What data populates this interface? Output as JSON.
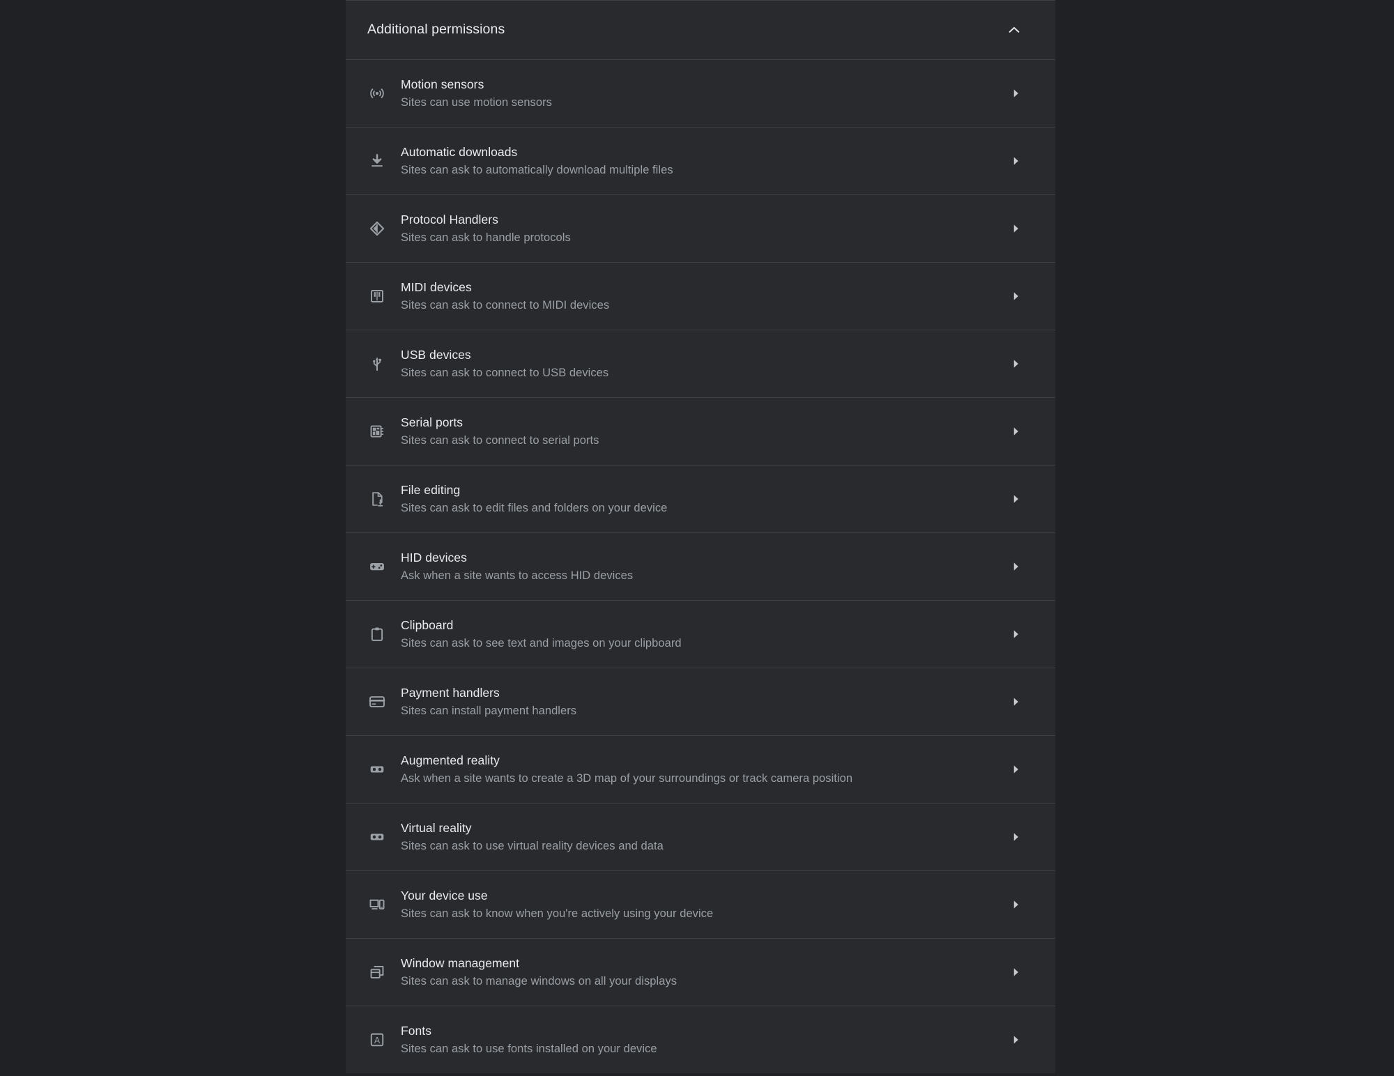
{
  "theme": {
    "page_bg": "#202124",
    "card_bg": "#292a2d",
    "divider": "#3c4043",
    "title_color": "#e8eaed",
    "desc_color": "#9aa0a6",
    "icon_color": "#9aa0a6",
    "arrow_color": "#c5c8cc"
  },
  "section": {
    "header_title": "Additional permissions",
    "collapse_icon": "chevron-up-icon",
    "expanded": true
  },
  "permissions": [
    {
      "id": "motion-sensors",
      "title": "Motion sensors",
      "description": "Sites can use motion sensors",
      "icon": "motion-sensor-icon",
      "arrow": "chevron-right-icon"
    },
    {
      "id": "automatic-downloads",
      "title": "Automatic downloads",
      "description": "Sites can ask to automatically download multiple files",
      "icon": "download-icon",
      "arrow": "chevron-right-icon"
    },
    {
      "id": "protocol-handlers",
      "title": "Protocol Handlers",
      "description": "Sites can ask to handle protocols",
      "icon": "protocol-handler-icon",
      "arrow": "chevron-right-icon"
    },
    {
      "id": "midi-devices",
      "title": "MIDI devices",
      "description": "Sites can ask to connect to MIDI devices",
      "icon": "piano-keys-icon",
      "arrow": "chevron-right-icon"
    },
    {
      "id": "usb-devices",
      "title": "USB devices",
      "description": "Sites can ask to connect to USB devices",
      "icon": "usb-icon",
      "arrow": "chevron-right-icon"
    },
    {
      "id": "serial-ports",
      "title": "Serial ports",
      "description": "Sites can ask to connect to serial ports",
      "icon": "chip-icon",
      "arrow": "chevron-right-icon"
    },
    {
      "id": "file-editing",
      "title": "File editing",
      "description": "Sites can ask to edit files and folders on your device",
      "icon": "file-edit-icon",
      "arrow": "chevron-right-icon"
    },
    {
      "id": "hid-devices",
      "title": "HID devices",
      "description": "Ask when a site wants to access HID devices",
      "icon": "gamepad-icon",
      "arrow": "chevron-right-icon"
    },
    {
      "id": "clipboard",
      "title": "Clipboard",
      "description": "Sites can ask to see text and images on your clipboard",
      "icon": "clipboard-icon",
      "arrow": "chevron-right-icon"
    },
    {
      "id": "payment-handlers",
      "title": "Payment handlers",
      "description": "Sites can install payment handlers",
      "icon": "credit-card-icon",
      "arrow": "chevron-right-icon"
    },
    {
      "id": "augmented-reality",
      "title": "Augmented reality",
      "description": "Ask when a site wants to create a 3D map of your surroundings or track camera position",
      "icon": "vr-headset-icon",
      "arrow": "chevron-right-icon"
    },
    {
      "id": "virtual-reality",
      "title": "Virtual reality",
      "description": "Sites can ask to use virtual reality devices and data",
      "icon": "vr-headset-icon",
      "arrow": "chevron-right-icon"
    },
    {
      "id": "your-device-use",
      "title": "Your device use",
      "description": "Sites can ask to know when you're actively using your device",
      "icon": "devices-icon",
      "arrow": "chevron-right-icon"
    },
    {
      "id": "window-management",
      "title": "Window management",
      "description": "Sites can ask to manage windows on all your displays",
      "icon": "windows-stack-icon",
      "arrow": "chevron-right-icon"
    },
    {
      "id": "fonts",
      "title": "Fonts",
      "description": "Sites can ask to use fonts installed on your device",
      "icon": "font-a-icon",
      "arrow": "chevron-right-icon"
    }
  ]
}
